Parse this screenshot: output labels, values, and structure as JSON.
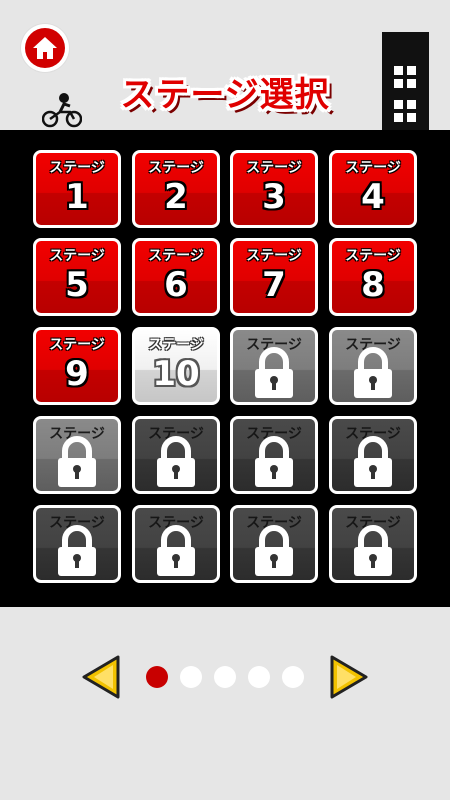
{
  "header": {
    "title": "ステージ選択",
    "home_icon": "home-icon",
    "accent": "#d10000"
  },
  "stages": [
    {
      "label": "ステージ",
      "number": "1",
      "state": "cleared"
    },
    {
      "label": "ステージ",
      "number": "2",
      "state": "cleared"
    },
    {
      "label": "ステージ",
      "number": "3",
      "state": "cleared"
    },
    {
      "label": "ステージ",
      "number": "4",
      "state": "cleared"
    },
    {
      "label": "ステージ",
      "number": "5",
      "state": "cleared"
    },
    {
      "label": "ステージ",
      "number": "6",
      "state": "cleared"
    },
    {
      "label": "ステージ",
      "number": "7",
      "state": "cleared"
    },
    {
      "label": "ステージ",
      "number": "8",
      "state": "cleared"
    },
    {
      "label": "ステージ",
      "number": "9",
      "state": "cleared"
    },
    {
      "label": "ステージ",
      "number": "10",
      "state": "current"
    },
    {
      "label": "ステージ",
      "number": "",
      "state": "locked"
    },
    {
      "label": "ステージ",
      "number": "",
      "state": "locked"
    },
    {
      "label": "ステージ",
      "number": "",
      "state": "locked"
    },
    {
      "label": "ステージ",
      "number": "",
      "state": "locked"
    },
    {
      "label": "ステージ",
      "number": "",
      "state": "locked"
    },
    {
      "label": "ステージ",
      "number": "",
      "state": "locked"
    },
    {
      "label": "ステージ",
      "number": "",
      "state": "locked"
    },
    {
      "label": "ステージ",
      "number": "",
      "state": "locked"
    },
    {
      "label": "ステージ",
      "number": "",
      "state": "locked"
    },
    {
      "label": "ステージ",
      "number": "",
      "state": "locked"
    }
  ],
  "pager": {
    "page_count": 5,
    "current_page": 1,
    "prev_icon": "arrow-left-icon",
    "next_icon": "arrow-right-icon",
    "arrow_color": "#f2c200",
    "active_dot_color": "#c80000"
  }
}
